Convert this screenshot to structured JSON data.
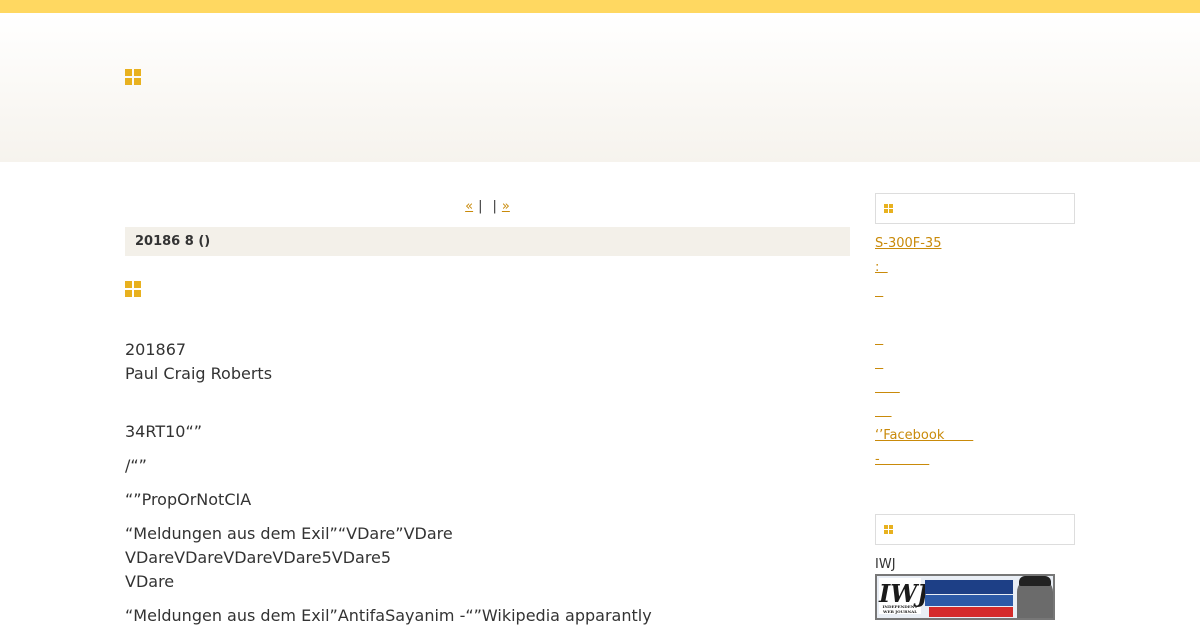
{
  "colors": {
    "topbar": "#ffd861",
    "accent": "#e8b11f",
    "link": "#c98a0a",
    "datebar": "#f3f0e9"
  },
  "header": {
    "icon": "grid-squares-icon"
  },
  "pager": {
    "prev": "« ",
    "sep1": "|",
    "middle": "    ",
    "sep2": "|",
    "next": " »      "
  },
  "post": {
    "date": "20186 8 ()",
    "icon": "grid-squares-icon",
    "lines": [
      "201867",
      "Paul Craig Roberts"
    ],
    "paragraphs": [
      "34RT10“”",
      "/“”",
      "“”PropOrNotCIA",
      "“Meldungen aus dem Exil”“VDare”VDare",
      "VDareVDareVDareVDare5VDare5",
      "VDare",
      "“Meldungen aus dem Exil”AntifaSayanim -“”Wikipedia apparantly"
    ]
  },
  "sidebar": {
    "box1_icon": "small-grid-icon",
    "links": [
      "S-300F-35",
      ":  ",
      "  ",
      "  ",
      "  ",
      "      ",
      "    ",
      "‘’Facebook       ",
      "-            "
    ],
    "box2_icon": "small-grid-icon",
    "iwj_label": "IWJ"
  }
}
